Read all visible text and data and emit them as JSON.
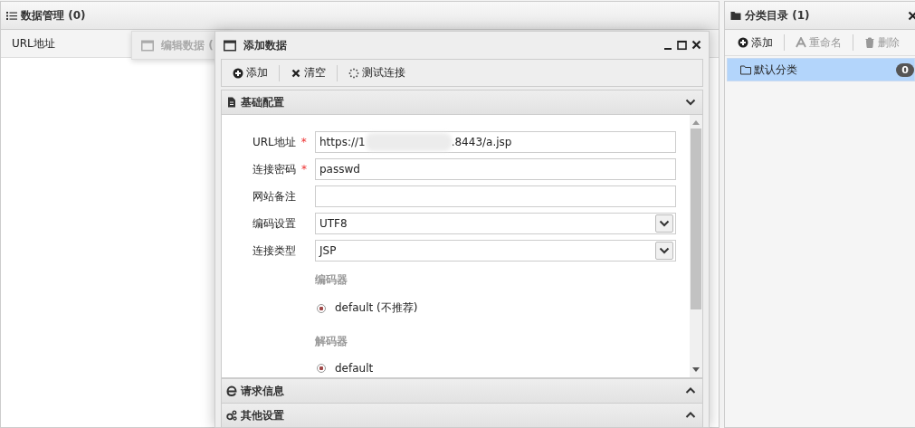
{
  "main_panel": {
    "title": "数据管理 (0)",
    "columns": [
      "URL地址"
    ]
  },
  "background_window": {
    "title": "编辑数据 ("
  },
  "dialog": {
    "title": "添加数据",
    "toolbar": [
      {
        "label": "添加"
      },
      {
        "label": "清空"
      },
      {
        "label": "测试连接"
      }
    ],
    "sections": [
      {
        "title": "基础配置",
        "expanded": true,
        "form": [
          {
            "kind": "text",
            "label": "URL地址",
            "required_mark": "*",
            "value_parts": [
              "https://1",
              ".8443/a.jsp"
            ]
          },
          {
            "kind": "text",
            "label": "连接密码",
            "required_mark": "*",
            "value_parts": [
              "passwd"
            ]
          },
          {
            "kind": "text",
            "label": "网站备注"
          },
          {
            "kind": "select",
            "label": "编码设置",
            "value_parts": [
              "UTF8"
            ]
          },
          {
            "kind": "select",
            "label": "连接类型",
            "value_parts": [
              "JSP"
            ]
          }
        ],
        "radio_groups": [
          {
            "title": "编码器",
            "options": [
              {
                "label": "default (不推荐)",
                "selected": true
              }
            ]
          },
          {
            "title": "解码器",
            "options": [
              {
                "label": "default",
                "selected": true
              }
            ]
          }
        ]
      },
      {
        "title": "请求信息",
        "expanded": false
      },
      {
        "title": "其他设置",
        "expanded": false
      }
    ]
  },
  "category_panel": {
    "title": "分类目录 (1)",
    "toolbar": [
      {
        "label": "添加",
        "disabled": false
      },
      {
        "label": "重命名",
        "disabled": true
      },
      {
        "label": "删除",
        "disabled": true
      }
    ],
    "items": [
      {
        "label": "默认分类",
        "count": "0",
        "selected": true
      }
    ]
  }
}
